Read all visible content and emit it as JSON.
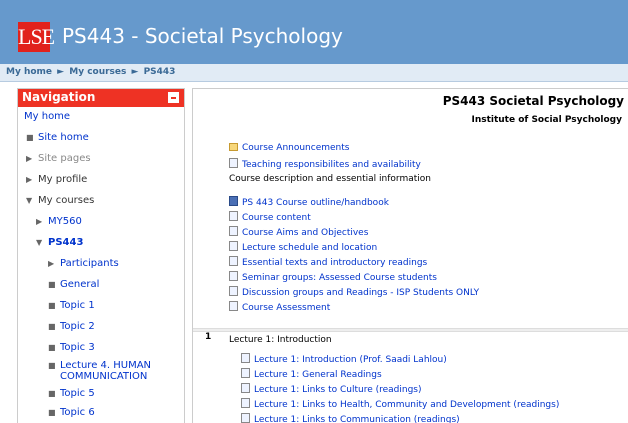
{
  "header": {
    "logo_text": "LSE",
    "title": "PS443 - Societal Psychology"
  },
  "breadcrumb": {
    "items": [
      "My home",
      "My courses",
      "PS443"
    ],
    "separator": "►"
  },
  "navigation": {
    "title": "Navigation",
    "items": [
      {
        "label": "My home"
      },
      {
        "label": "Site home",
        "marker": "■"
      },
      {
        "label": "Site pages",
        "marker": "▶"
      },
      {
        "label": "My profile",
        "marker": "▶"
      },
      {
        "label": "My courses",
        "marker": "▼"
      },
      {
        "label": "MY560",
        "marker": "▶"
      },
      {
        "label": "PS443",
        "marker": "▼"
      },
      {
        "label": "Participants",
        "marker": "▶"
      },
      {
        "label": "General",
        "marker": "■"
      },
      {
        "label": "Topic 1",
        "marker": "■"
      },
      {
        "label": "Topic 2",
        "marker": "■"
      },
      {
        "label": "Topic 3",
        "marker": "■"
      },
      {
        "label": "Lecture 4. HUMAN COMMUNICATION",
        "marker": "■"
      },
      {
        "label": "Topic 5",
        "marker": "■"
      },
      {
        "label": "Topic 6",
        "marker": "■"
      }
    ]
  },
  "main": {
    "course_title": "PS443  Societal Psychology",
    "course_subtitle": "Institute of Social Psychology",
    "top_resources": [
      {
        "label": "Course Announcements",
        "icon": "folder-icon"
      },
      {
        "label": "Teaching responsibilites and availability",
        "icon": "file-icon"
      }
    ],
    "course_description": "Course description and essential information",
    "resources": [
      {
        "label": "PS 443 Course outline/handbook",
        "icon": "book-icon"
      },
      {
        "label": "Course content",
        "icon": "file-icon"
      },
      {
        "label": "Course Aims and Objectives",
        "icon": "file-icon"
      },
      {
        "label": "Lecture schedule and location",
        "icon": "file-icon"
      },
      {
        "label": "Essential texts and introductory readings",
        "icon": "file-icon"
      },
      {
        "label": "Seminar groups: Assessed Course students",
        "icon": "file-icon"
      },
      {
        "label": "Discussion groups and Readings - ISP Students ONLY",
        "icon": "file-icon"
      },
      {
        "label": "Course Assessment",
        "icon": "file-icon"
      }
    ],
    "section1": {
      "number": "1",
      "title": "Lecture 1: Introduction",
      "items": [
        {
          "label": "Lecture 1: Introduction (Prof. Saadi Lahlou)",
          "icon": "file-icon"
        },
        {
          "label": "Lecture 1: General Readings",
          "icon": "file-icon"
        },
        {
          "label": "Lecture 1: Links to Culture (readings)",
          "icon": "file-icon"
        },
        {
          "label": "Lecture 1: Links to Health, Community and Development (readings)",
          "icon": "file-icon"
        },
        {
          "label": "Lecture 1: Links to Communication (readings)",
          "icon": "file-icon"
        }
      ]
    }
  }
}
